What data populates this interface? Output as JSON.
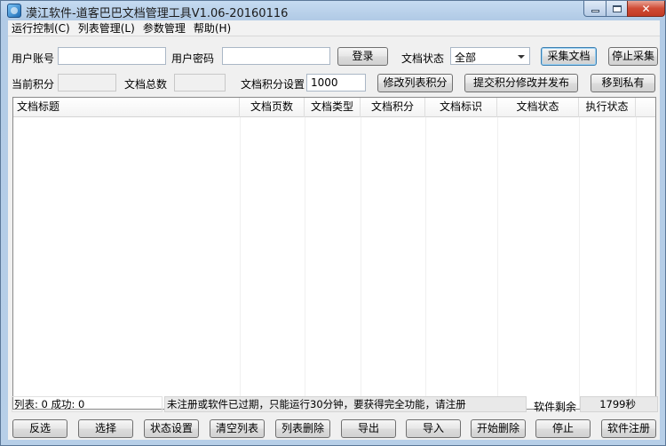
{
  "window": {
    "title": "漠江软件-道客巴巴文档管理工具V1.06-20160116"
  },
  "menu": [
    "运行控制(C)",
    "列表管理(L)",
    "参数管理",
    "帮助(H)"
  ],
  "form": {
    "account_label": "用户账号",
    "account_value": "",
    "password_label": "用户密码",
    "password_value": "",
    "login_button": "登录",
    "doc_status_label": "文档状态",
    "doc_status_value": "全部",
    "collect_button": "采集文档",
    "stop_collect_button": "停止采集",
    "current_points_label": "当前积分",
    "current_points_value": "",
    "doc_total_label": "文档总数",
    "doc_total_value": "",
    "points_setting_label": "文档积分设置",
    "points_setting_value": "1000",
    "modify_list_points_button": "修改列表积分",
    "submit_points_button": "提交积分修改并发布",
    "move_private_button": "移到私有"
  },
  "table": {
    "columns": [
      "文档标题",
      "文档页数",
      "文档类型",
      "文档积分",
      "文档标识",
      "文档状态",
      "执行状态"
    ],
    "rows": []
  },
  "statusbar": {
    "counts": "列表: 0  成功: 0",
    "notice": "未注册或软件已过期，只能运行30分钟，要获得完全功能，请注册",
    "remaining_label": "软件剩余",
    "remaining_value": "1799秒"
  },
  "bottom_buttons": [
    "反选",
    "选择",
    "状态设置",
    "清空列表",
    "列表删除",
    "导出",
    "导入",
    "开始删除",
    "停止",
    "软件注册"
  ]
}
